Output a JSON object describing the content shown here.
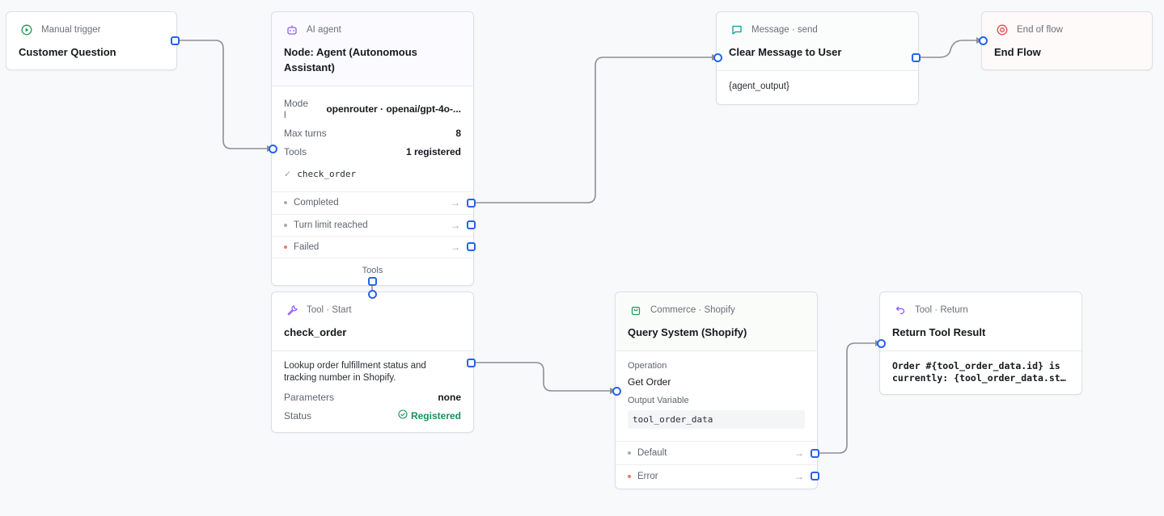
{
  "nodes": {
    "trigger": {
      "kind": "Manual trigger",
      "title": "Customer Question"
    },
    "agent": {
      "kind": "AI agent",
      "title": "Node: Agent (Autonomous Assistant)",
      "model_label": "Mode\nl",
      "model_value": "openrouter · openai/gpt-4o-...",
      "max_turns_label": "Max turns",
      "max_turns_value": "8",
      "tools_label": "Tools",
      "tools_value": "1 registered",
      "tool_item": "check_order",
      "outputs": [
        "Completed",
        "Turn limit reached",
        "Failed"
      ],
      "tools_port_label": "Tools"
    },
    "message": {
      "kind": "Message · send",
      "title": "Clear Message to User",
      "body": "{agent_output}"
    },
    "end": {
      "kind": "End of flow",
      "title": "End Flow"
    },
    "tool_start": {
      "kind": "Tool · Start",
      "title": "check_order",
      "description": "Lookup order fulfillment status and tracking number in Shopify.",
      "params_label": "Parameters",
      "params_value": "none",
      "status_label": "Status",
      "status_value": "Registered"
    },
    "shopify": {
      "kind": "Commerce · Shopify",
      "title": "Query System (Shopify)",
      "operation_label": "Operation",
      "operation_value": "Get Order",
      "output_var_label": "Output Variable",
      "output_var_value": "tool_order_data",
      "outputs": [
        "Default",
        "Error"
      ]
    },
    "tool_return": {
      "kind": "Tool · Return",
      "title": "Return Tool Result",
      "body_line1": "Order #{tool_order_data.id} is",
      "body_line2": "currently: {tool_order_data.st…"
    }
  },
  "colors": {
    "port": "#2563eb",
    "trigger_accent": "#1a9b5a",
    "agent_accent": "#8b5cf6",
    "message_accent": "#0f9f8f",
    "end_accent": "#e5484d",
    "registered": "#1a8f5a"
  }
}
